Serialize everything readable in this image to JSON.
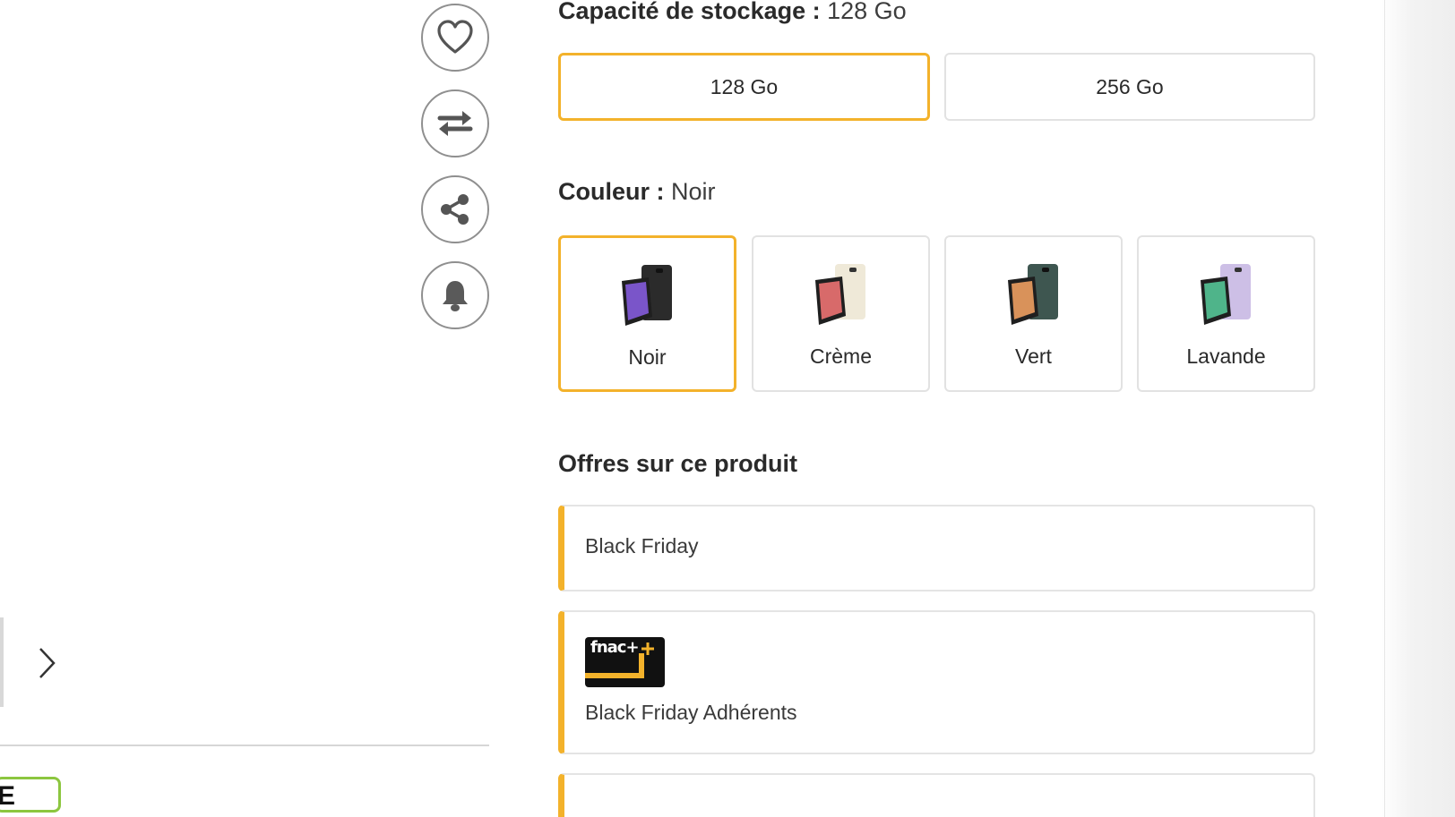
{
  "actions": {
    "favorite": "heart-icon",
    "compare": "compare-arrows-icon",
    "share": "share-icon",
    "alert": "bell-icon"
  },
  "storage": {
    "title": "Capacité de stockage : ",
    "selected_value": "128 Go",
    "options": [
      {
        "label": "128 Go",
        "selected": true
      },
      {
        "label": "256 Go",
        "selected": false
      }
    ]
  },
  "color": {
    "title": "Couleur : ",
    "selected_value": "Noir",
    "options": [
      {
        "label": "Noir",
        "selected": true,
        "back": "#2b2b2b",
        "front": "#7a55c9"
      },
      {
        "label": "Crème",
        "selected": false,
        "back": "#efe9d8",
        "front": "#d86a6a"
      },
      {
        "label": "Vert",
        "selected": false,
        "back": "#3e5650",
        "front": "#d9925a"
      },
      {
        "label": "Lavande",
        "selected": false,
        "back": "#cdbfe6",
        "front": "#4fb48a"
      }
    ]
  },
  "offers": {
    "title": "Offres sur ce produit",
    "items": [
      {
        "label": "Black Friday"
      },
      {
        "label": "Black Friday Adhérents",
        "logo_text": "fnac+"
      }
    ]
  },
  "energy_badge": "E",
  "colors": {
    "accent": "#f3b22b",
    "border": "#e2e2e2",
    "text": "#2a2a2a"
  }
}
